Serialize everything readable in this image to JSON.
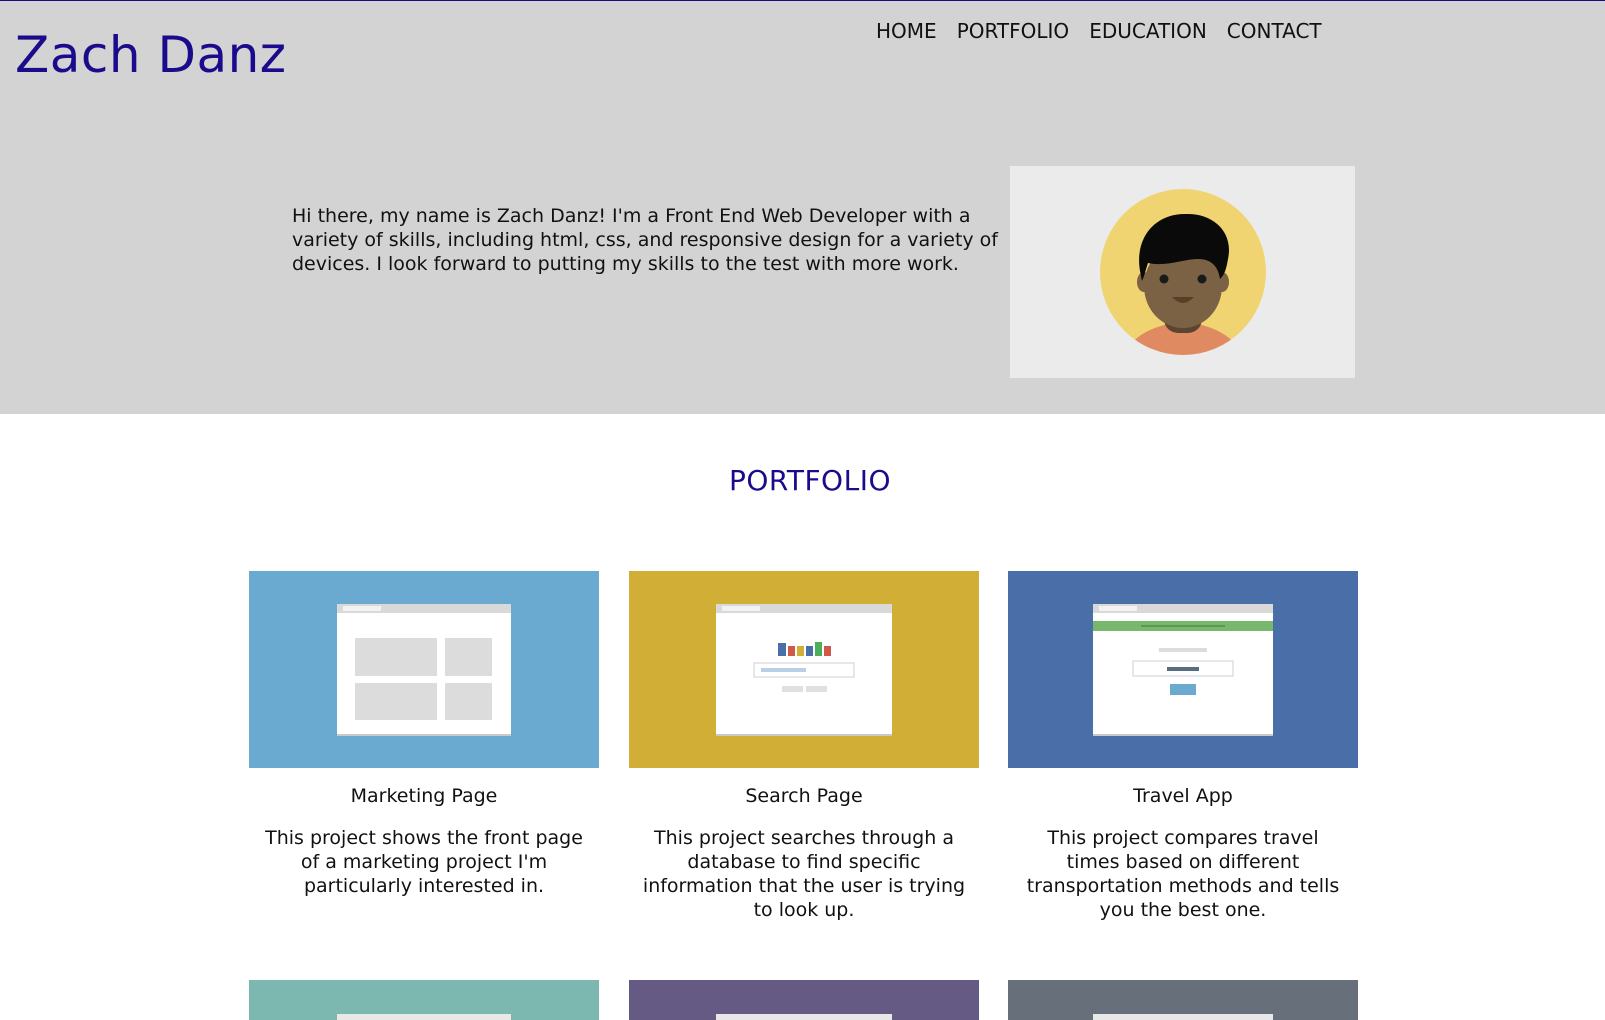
{
  "header": {
    "brand": "Zach Danz",
    "nav": [
      "HOME",
      "PORTFOLIO",
      "EDUCATION",
      "CONTACT"
    ]
  },
  "hero": {
    "intro": "Hi there, my name is Zach Danz! I'm a Front End Web Developer with a variety of skills, including html, css, and responsive design for a variety of devices. I look forward to putting my skills to the test with more work."
  },
  "portfolio": {
    "heading": "PORTFOLIO",
    "projects": [
      {
        "title": "Marketing Page",
        "description": "This project shows the front page of a marketing project I'm particularly interested in.",
        "color": "#6aaad0"
      },
      {
        "title": "Search Page",
        "description": "This project searches through a database to find specific information that the user is trying to look up.",
        "color": "#d1ae36"
      },
      {
        "title": "Travel App",
        "description": "This project compares travel times based on different transportation methods and tells you the best one.",
        "color": "#4a6ea8"
      }
    ],
    "more_thumbnail_colors": [
      "#7cb8b0",
      "#655a84",
      "#676f7a"
    ]
  },
  "colors": {
    "accent": "#1a0a8c",
    "hero_bg": "#d3d3d3"
  }
}
